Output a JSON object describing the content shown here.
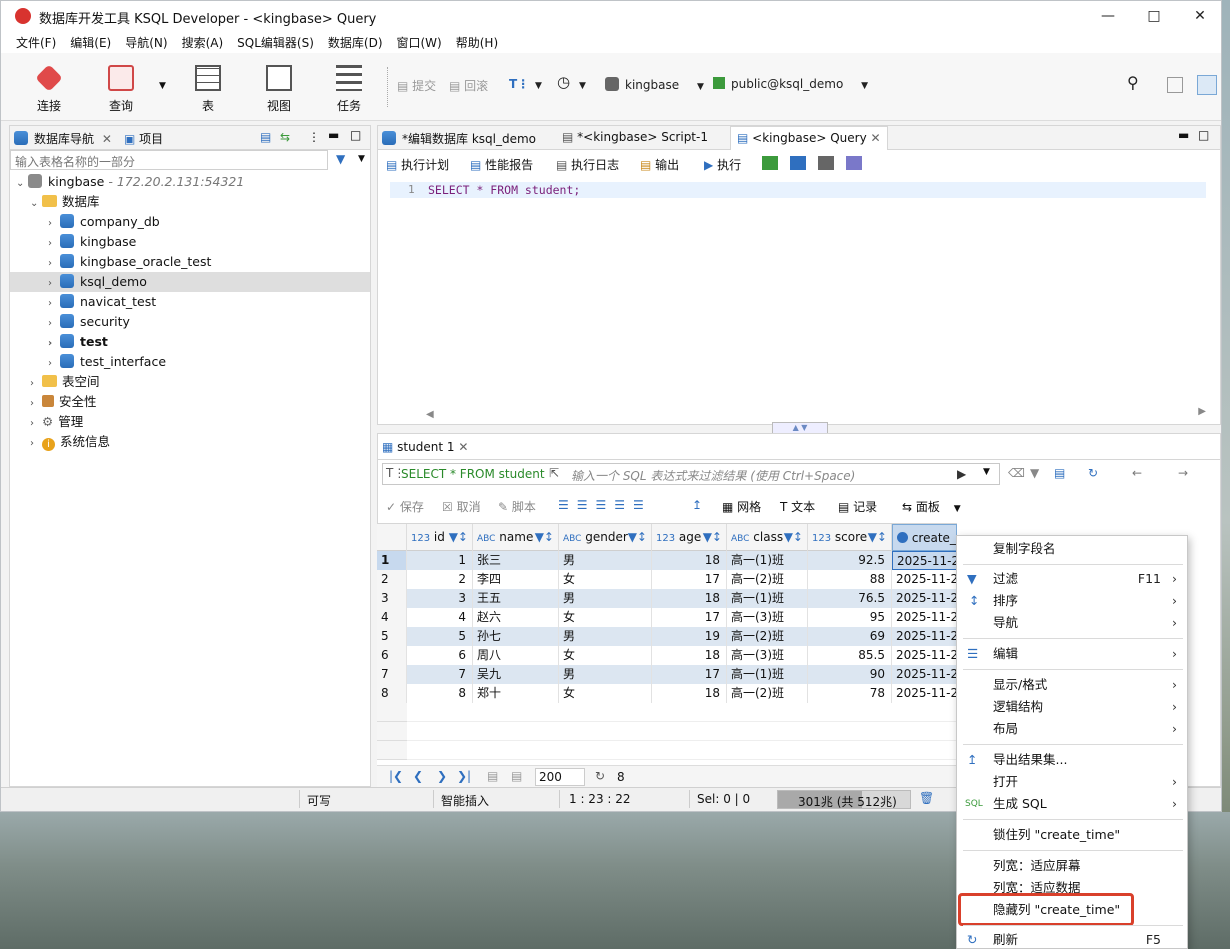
{
  "window": {
    "title": "数据库开发工具 KSQL Developer - <kingbase> Query"
  },
  "menu": [
    "文件(F)",
    "编辑(E)",
    "导航(N)",
    "搜索(A)",
    "SQL编辑器(S)",
    "数据库(D)",
    "窗口(W)",
    "帮助(H)"
  ],
  "toolbar": {
    "connect": "连接",
    "query": "查询",
    "table": "表",
    "view": "视图",
    "task": "任务",
    "commit": "提交",
    "rollback": "回滚",
    "datasource": "kingbase",
    "schema": "public@ksql_demo"
  },
  "nav": {
    "tab_db": "数据库导航",
    "tab_project": "项目",
    "filter_placeholder": "输入表格名称的一部分",
    "server": "kingbase",
    "server_addr": " - 172.20.2.131:54321",
    "databases_label": "数据库",
    "databases": [
      "company_db",
      "kingbase",
      "kingbase_oracle_test",
      "ksql_demo",
      "navicat_test",
      "security",
      "test",
      "test_interface"
    ],
    "others": [
      "表空间",
      "安全性",
      "管理",
      "系统信息"
    ]
  },
  "editor": {
    "tabs": [
      "*编辑数据库 ksql_demo",
      "*<kingbase> Script-1",
      "<kingbase> Query"
    ],
    "actions": [
      "执行计划",
      "性能报告",
      "执行日志",
      "输出",
      "执行"
    ],
    "line_no": "1",
    "sql": "SELECT * FROM student;"
  },
  "results": {
    "tab": "student 1",
    "query": "SELECT * FROM student",
    "filter_placeholder": "输入一个 SQL 表达式来过滤结果 (使用 Ctrl+Space)",
    "actions": [
      "保存",
      "取消",
      "脚本",
      "网格",
      "文本",
      "记录",
      "面板"
    ],
    "columns": [
      {
        "type": "123",
        "name": "id"
      },
      {
        "type": "ABC",
        "name": "name"
      },
      {
        "type": "ABC",
        "name": "gender"
      },
      {
        "type": "123",
        "name": "age"
      },
      {
        "type": "ABC",
        "name": "class"
      },
      {
        "type": "123",
        "name": "score"
      },
      {
        "type": "clock",
        "name": "create_t"
      }
    ],
    "rows": [
      {
        "n": "1",
        "id": "1",
        "name": "张三",
        "gender": "男",
        "age": "18",
        "class": "高一(1)班",
        "score": "92.5",
        "ct": "2025-11-27"
      },
      {
        "n": "2",
        "id": "2",
        "name": "李四",
        "gender": "女",
        "age": "17",
        "class": "高一(2)班",
        "score": "88",
        "ct": "2025-11-27"
      },
      {
        "n": "3",
        "id": "3",
        "name": "王五",
        "gender": "男",
        "age": "18",
        "class": "高一(1)班",
        "score": "76.5",
        "ct": "2025-11-27"
      },
      {
        "n": "4",
        "id": "4",
        "name": "赵六",
        "gender": "女",
        "age": "17",
        "class": "高一(3)班",
        "score": "95",
        "ct": "2025-11-27"
      },
      {
        "n": "5",
        "id": "5",
        "name": "孙七",
        "gender": "男",
        "age": "19",
        "class": "高一(2)班",
        "score": "69",
        "ct": "2025-11-27"
      },
      {
        "n": "6",
        "id": "6",
        "name": "周八",
        "gender": "女",
        "age": "18",
        "class": "高一(3)班",
        "score": "85.5",
        "ct": "2025-11-27"
      },
      {
        "n": "7",
        "id": "7",
        "name": "吴九",
        "gender": "男",
        "age": "17",
        "class": "高一(1)班",
        "score": "90",
        "ct": "2025-11-27"
      },
      {
        "n": "8",
        "id": "8",
        "name": "郑十",
        "gender": "女",
        "age": "18",
        "class": "高一(2)班",
        "score": "78",
        "ct": "2025-11-27"
      }
    ],
    "page_size": "200",
    "fetched": "8"
  },
  "status": {
    "writable": "可写",
    "insert": "智能插入",
    "pos": "1 : 23 : 22",
    "sel": "Sel: 0 | 0",
    "memory": "301兆 (共 512兆)"
  },
  "context_menu": {
    "copy_name": "复制字段名",
    "filter": "过滤",
    "filter_key": "F11",
    "sort": "排序",
    "navigate": "导航",
    "edit": "编辑",
    "display": "显示/格式",
    "logical": "逻辑结构",
    "layout": "布局",
    "export": "导出结果集...",
    "open": "打开",
    "gen_sql": "生成 SQL",
    "pin": "锁住列 \"create_time\"",
    "fit_screen": "列宽：适应屏幕",
    "fit_data": "列宽：适应数据",
    "hide": "隐藏列 \"create_time\"",
    "refresh": "刷新",
    "refresh_key": "F5"
  },
  "colors": {
    "accent": "#2f6fbf",
    "highlight_box": "#d9402b",
    "row_sel": "#c7d9ee"
  }
}
